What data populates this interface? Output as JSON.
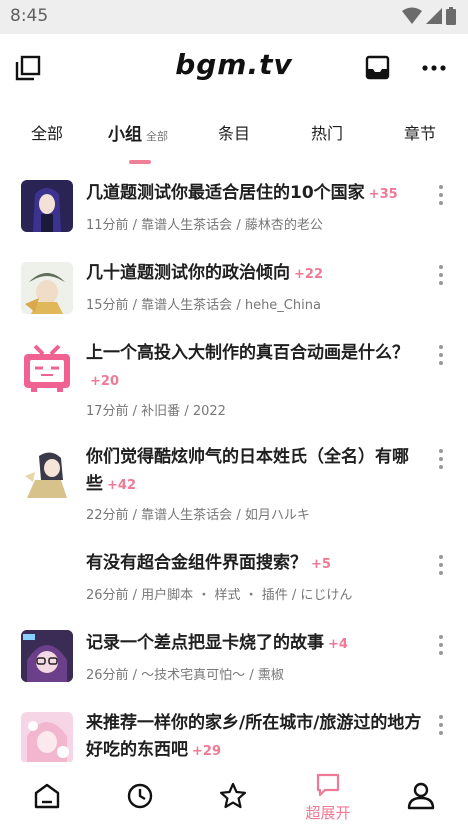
{
  "status_bar": {
    "time": "8:45"
  },
  "app_bar": {
    "title": "bgm.tv"
  },
  "tabs": [
    {
      "label": "全部",
      "sub": ""
    },
    {
      "label": "小组",
      "sub": "全部"
    },
    {
      "label": "条目",
      "sub": ""
    },
    {
      "label": "热门",
      "sub": ""
    },
    {
      "label": "章节",
      "sub": ""
    }
  ],
  "topics": [
    {
      "title": "几道题测试你最适合居住的10个国家",
      "replies": "+35",
      "meta": "11分前 / 靠谱人生茶话会 / 藤林杏的老公"
    },
    {
      "title": "几十道题测试你的政治倾向",
      "replies": "+22",
      "meta": "15分前 / 靠谱人生茶话会 / hehe_China"
    },
    {
      "title": "上一个高投入大制作的真百合动画是什么？",
      "replies": "+20",
      "meta": "17分前 / 补旧番 / 2022"
    },
    {
      "title": "你们觉得酷炫帅气的日本姓氏（全名）有哪些",
      "replies": "+42",
      "meta": "22分前 / 靠谱人生茶话会 / 如月ハルキ"
    },
    {
      "title": "有没有超合金组件界面搜索？",
      "replies": "+5",
      "meta": "26分前 / 用户脚本 ・ 样式 ・ 插件 / にじけん"
    },
    {
      "title": "记录一个差点把显卡烧了的故事",
      "replies": "+4",
      "meta": "26分前 / 〜技术宅真可怕〜 / 熏椒"
    },
    {
      "title": "来推荐一样你的家乡/所在城市/旅游过的地方好吃的东西吧",
      "replies": "+29",
      "meta": ""
    }
  ],
  "bottom_nav": {
    "active_label": "超展开"
  },
  "colors": {
    "accent": "#f07a95",
    "status_bar": "#eeeeee",
    "text": "#1f1f1f",
    "meta": "#777777"
  }
}
